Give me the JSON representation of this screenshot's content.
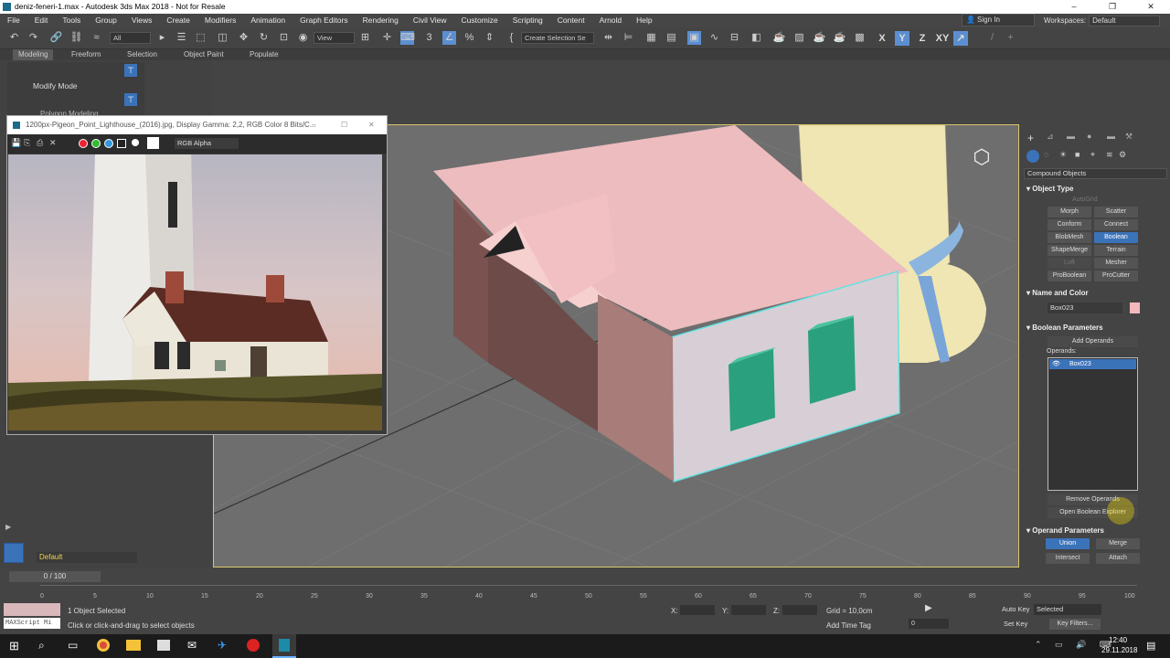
{
  "window": {
    "title": "deniz-feneri-1.max - Autodesk 3ds Max 2018 - Not for Resale",
    "controls": [
      "–",
      "❐",
      "✕"
    ]
  },
  "menu": [
    "File",
    "Edit",
    "Tools",
    "Group",
    "Views",
    "Create",
    "Modifiers",
    "Animation",
    "Graph Editors",
    "Rendering",
    "Civil View",
    "Customize",
    "Scripting",
    "Content",
    "Arnold",
    "Help"
  ],
  "account": {
    "sign_in": "Sign In",
    "workspaces_label": "Workspaces:",
    "workspace": "Default"
  },
  "toolbar": {
    "filter": "All",
    "refcoord": "View",
    "selection_set_placeholder": "Create Selection Se",
    "axes": [
      "X",
      "Y",
      "Z",
      "XY"
    ]
  },
  "ribbon": {
    "tabs": [
      "Modeling",
      "Freeform",
      "Selection",
      "Object Paint",
      "Populate"
    ],
    "mode": "Modify Mode",
    "group": "Polygon Modeling"
  },
  "image_window": {
    "title": "1200px-Pigeon_Point_Lighthouse_(2016).jpg, Display Gamma: 2,2, RGB Color 8 Bits/C...",
    "channel": "RGB Alpha"
  },
  "right_panel": {
    "category": "Compound Objects",
    "object_type": {
      "title": "Object Type",
      "autogrid": "AutoGrid",
      "buttons": [
        "Morph",
        "Scatter",
        "Conform",
        "Connect",
        "BlobMesh",
        "Boolean",
        "ShapeMerge",
        "Terrain",
        "Loft",
        "Mesher",
        "ProBoolean",
        "ProCutter"
      ]
    },
    "name_color": {
      "title": "Name and Color",
      "name": "Box023",
      "color": "#f2b8bd"
    },
    "boolean_params": {
      "title": "Boolean Parameters",
      "add": "Add Operands",
      "operands_label": "Operands:",
      "operands": [
        "Box023"
      ],
      "remove": "Remove Operands",
      "explorer": "Open Boolean Explorer"
    },
    "operand_params": {
      "title": "Operand Parameters",
      "ops": [
        "Union",
        "Merge",
        "Intersect",
        "Attach"
      ]
    }
  },
  "timeline": {
    "frame": "0 / 100",
    "ticks": [
      "0",
      "5",
      "10",
      "15",
      "20",
      "25",
      "30",
      "35",
      "40",
      "45",
      "50",
      "55",
      "60",
      "65",
      "70",
      "75",
      "80",
      "85",
      "90",
      "95",
      "100"
    ]
  },
  "layer": "Default",
  "status": {
    "maxscript": "MAXScript Mi",
    "selected": "1 Object Selected",
    "prompt": "Click or click-and-drag to select objects",
    "x_label": "X:",
    "y_label": "Y:",
    "z_label": "Z:",
    "grid": "Grid = 10,0cm",
    "add_time_tag": "Add Time Tag",
    "auto_key": "Auto Key",
    "set_key": "Set Key",
    "key_mode": "Selected",
    "key_filters": "Key Filters...",
    "current_frame": "0"
  },
  "taskbar": {
    "time": "12:40",
    "date": "29.11.2018"
  }
}
